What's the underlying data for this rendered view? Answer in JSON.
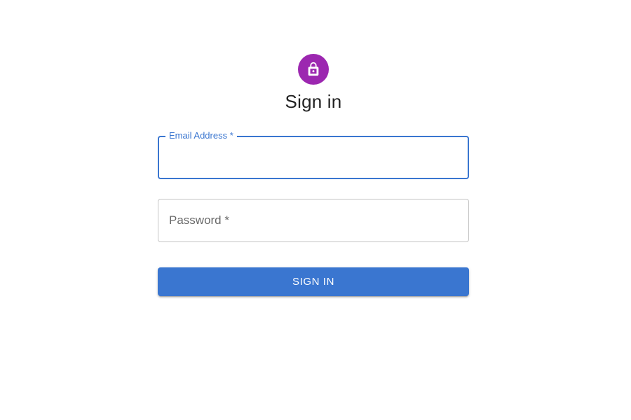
{
  "header": {
    "icon": "lock-icon",
    "title": "Sign in"
  },
  "form": {
    "email": {
      "label": "Email Address *",
      "value": ""
    },
    "password": {
      "label": "Password *",
      "value": ""
    },
    "submit_label": "SIGN IN"
  },
  "colors": {
    "avatar_bg": "#9c27b0",
    "primary": "#3a76d0",
    "focus_border": "#3a76d0"
  }
}
